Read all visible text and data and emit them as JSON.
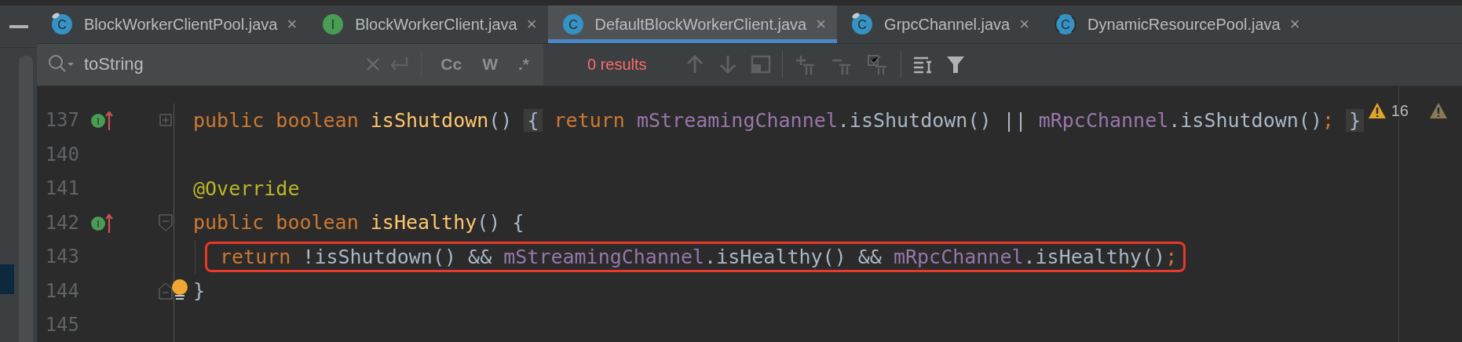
{
  "tabs": [
    {
      "label": "BlockWorkerClientPool.java",
      "icon": "C",
      "kind": "class",
      "badge": true,
      "selected": false,
      "close": "×"
    },
    {
      "label": "BlockWorkerClient.java",
      "icon": "I",
      "kind": "interface",
      "badge": false,
      "selected": false,
      "close": "×"
    },
    {
      "label": "DefaultBlockWorkerClient.java",
      "icon": "C",
      "kind": "class",
      "badge": false,
      "selected": true,
      "close": "×"
    },
    {
      "label": "GrpcChannel.java",
      "icon": "C",
      "kind": "class",
      "badge": true,
      "selected": false,
      "close": "×"
    },
    {
      "label": "DynamicResourcePool.java",
      "icon": "C",
      "kind": "abstract",
      "badge": false,
      "selected": false,
      "close": "×"
    }
  ],
  "search": {
    "value": "toString",
    "toggles": [
      "Cc",
      "W",
      ".*"
    ],
    "result": "0 results"
  },
  "editor": {
    "lines": [
      {
        "number": "137",
        "marker": "I",
        "kind": "collapsed",
        "highlighted": false,
        "indented": false,
        "tokens": [
          {
            "kind": "keyword",
            "text": "public boolean "
          },
          {
            "kind": "method",
            "text": "isShutdown"
          },
          {
            "kind": "plain",
            "text": "() "
          },
          {
            "kind": "folded",
            "text": "{"
          },
          {
            "kind": "keyword",
            "text": " return "
          },
          {
            "kind": "field",
            "text": "mStreamingChannel"
          },
          {
            "kind": "plain",
            "text": ".isShutdown() || "
          },
          {
            "kind": "field",
            "text": "mRpcChannel"
          },
          {
            "kind": "plain",
            "text": ".isShutdown()"
          },
          {
            "kind": "keyword",
            "text": "; "
          },
          {
            "kind": "folded",
            "text": "}"
          }
        ]
      },
      {
        "number": "140",
        "kind": "plain"
      },
      {
        "number": "141",
        "kind": "plain",
        "highlighted": false,
        "indented": false,
        "tokens": [
          {
            "kind": "annotation",
            "text": "@Override"
          }
        ]
      },
      {
        "number": "142",
        "marker": "I",
        "kind": "fold-start",
        "highlighted": false,
        "indented": false,
        "tokens": [
          {
            "kind": "keyword",
            "text": "public boolean "
          },
          {
            "kind": "method",
            "text": "isHealthy"
          },
          {
            "kind": "plain",
            "text": "() {"
          }
        ]
      },
      {
        "number": "143",
        "kind": "plain",
        "highlighted": true,
        "indented": true,
        "tokens": [
          {
            "kind": "keyword",
            "text": "return "
          },
          {
            "kind": "plain",
            "text": "!isShutdown() && "
          },
          {
            "kind": "field",
            "text": "mStreamingChannel"
          },
          {
            "kind": "plain",
            "text": ".isHealthy() && "
          },
          {
            "kind": "field",
            "text": "mRpcChannel"
          },
          {
            "kind": "plain",
            "text": ".isHealthy()"
          },
          {
            "kind": "keyword",
            "text": ";"
          }
        ]
      },
      {
        "number": "144",
        "kind": "fold-end",
        "highlighted": false,
        "indented": false,
        "bulb": true,
        "tokens": [
          {
            "kind": "plain",
            "text": "}"
          }
        ]
      },
      {
        "number": "145",
        "kind": "plain"
      }
    ],
    "warnings": "16"
  }
}
